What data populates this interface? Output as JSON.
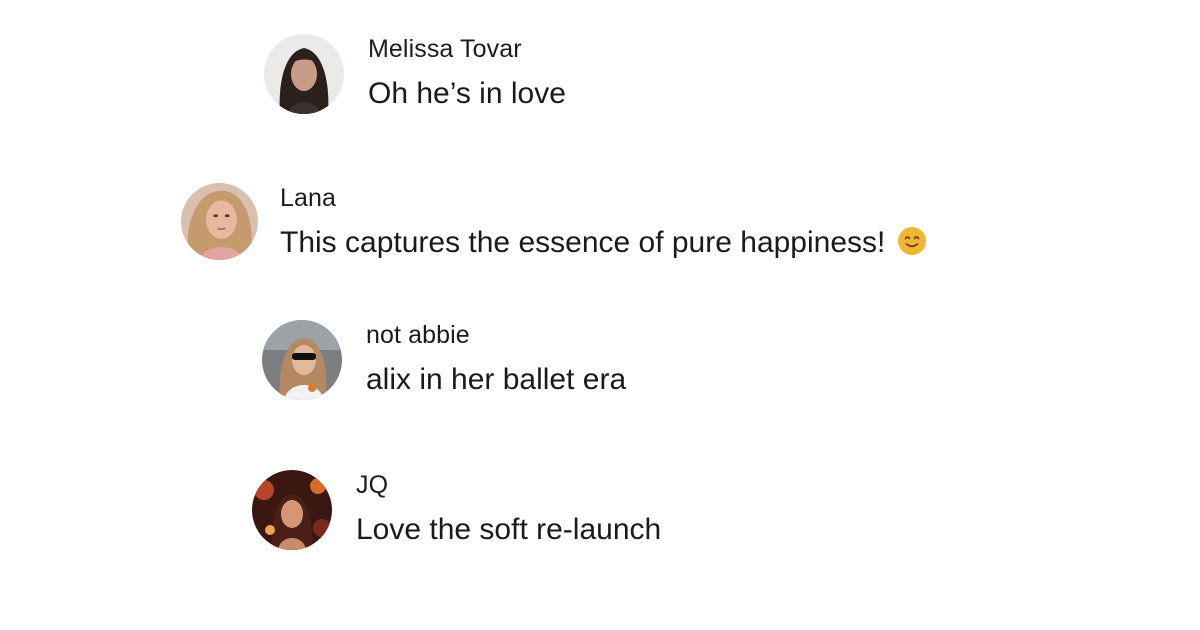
{
  "comments": [
    {
      "author": "Melissa Tovar",
      "text": "Oh he’s in love",
      "avatar_icon": "avatar-photo-icon"
    },
    {
      "author": "Lana",
      "text": "This captures the essence of pure happiness!",
      "emoji": "smiling-face-emoji-icon",
      "avatar_icon": "avatar-photo-icon"
    },
    {
      "author": "not abbie",
      "text": "alix in her ballet era",
      "avatar_icon": "avatar-photo-icon"
    },
    {
      "author": "JQ",
      "text": "Love the soft re-launch",
      "avatar_icon": "avatar-photo-icon"
    }
  ],
  "colors": {
    "background": "#ffffff",
    "text": "#1a1a1a",
    "emoji_face": "#f5b534"
  }
}
